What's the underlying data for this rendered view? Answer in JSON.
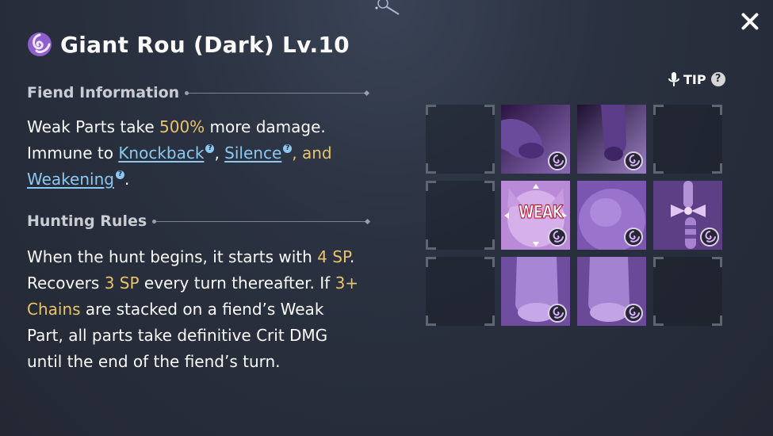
{
  "header": {
    "title": "Giant Rou (Dark) Lv.10",
    "element_icon": "dark-swirl-icon",
    "close_icon": "close-icon"
  },
  "fiend_info": {
    "heading": "Fiend Information",
    "line1_pre": "Weak Parts take ",
    "line1_value": "500%",
    "line1_post": " more damage.",
    "line2_pre": "Immune to ",
    "link1": "Knockback",
    "sep1": ", ",
    "link2": "Silence",
    "sep2": ", and",
    "link3": "Weakening",
    "end": "."
  },
  "hunting_rules": {
    "heading": "Hunting Rules",
    "t1": "When the hunt begins, it starts with ",
    "v1": "4 SP",
    "t2": ".",
    "t3": "Recovers ",
    "v2": "3 SP",
    "t4": " every turn thereafter. If ",
    "v3a": "3+",
    "v3b": "Chains",
    "t5": " are stacked on a fiend’s Weak",
    "t6": "Part, all parts take definitive Crit DMG",
    "t7": "until the end of the fiend’s turn."
  },
  "tip": {
    "label": "TIP",
    "help": "?"
  },
  "parts_grid": {
    "weak_label": "WEAK",
    "cells": [
      [
        "empty",
        "paw-left-top",
        "paw-right-top",
        "empty"
      ],
      [
        "empty",
        "head-weak",
        "body",
        "tail"
      ],
      [
        "empty",
        "foot-left",
        "foot-right",
        "empty"
      ]
    ]
  },
  "colors": {
    "accent_gold": "#e9c46a",
    "link_blue": "#8cc8f2",
    "part_purple": "#8e6ac7"
  }
}
